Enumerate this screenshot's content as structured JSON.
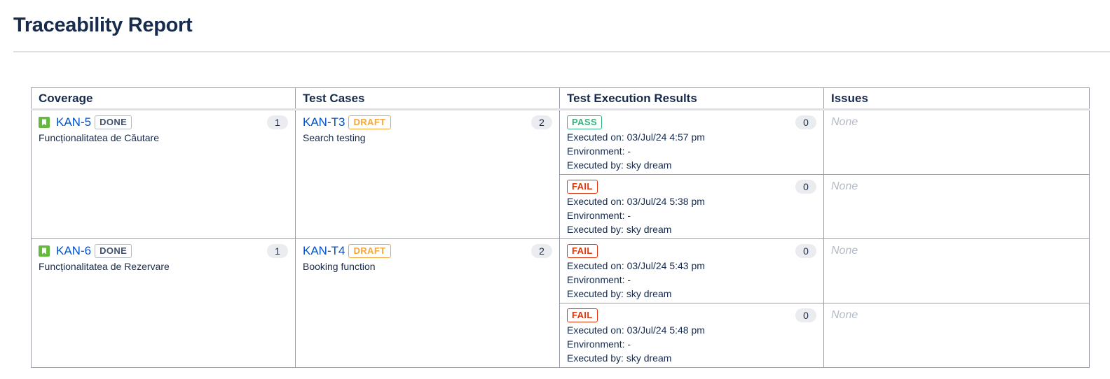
{
  "page": {
    "title": "Traceability Report"
  },
  "table": {
    "headers": [
      "Coverage",
      "Test Cases",
      "Test Execution Results",
      "Issues"
    ]
  },
  "rows": [
    {
      "coverage": {
        "key": "KAN-5",
        "status": "DONE",
        "summary": "Funcționalitatea de Căutare",
        "count": "1"
      },
      "test_case": {
        "key": "KAN-T3",
        "status": "DRAFT",
        "summary": "Search testing",
        "count": "2"
      },
      "executions": [
        {
          "result": "PASS",
          "count": "0",
          "executed_on": "Executed on: 03/Jul/24 4:57 pm",
          "environment": "Environment: -",
          "executed_by": "Executed by: sky dream",
          "issues": "None"
        },
        {
          "result": "FAIL",
          "count": "0",
          "executed_on": "Executed on: 03/Jul/24 5:38 pm",
          "environment": "Environment: -",
          "executed_by": "Executed by: sky dream",
          "issues": "None"
        }
      ]
    },
    {
      "coverage": {
        "key": "KAN-6",
        "status": "DONE",
        "summary": "Funcționalitatea de Rezervare",
        "count": "1"
      },
      "test_case": {
        "key": "KAN-T4",
        "status": "DRAFT",
        "summary": "Booking function",
        "count": "2"
      },
      "executions": [
        {
          "result": "FAIL",
          "count": "0",
          "executed_on": "Executed on: 03/Jul/24 5:43 pm",
          "environment": "Environment: -",
          "executed_by": "Executed by: sky dream",
          "issues": "None"
        },
        {
          "result": "FAIL",
          "count": "0",
          "executed_on": "Executed on: 03/Jul/24 5:48 pm",
          "environment": "Environment: -",
          "executed_by": "Executed by: sky dream",
          "issues": "None"
        }
      ]
    }
  ],
  "colors": {
    "link": "#0052cc",
    "story_icon": "#63ba3c",
    "pass": "#36b37e",
    "fail": "#de350b",
    "draft": "#f6a83c",
    "done": "#42526e"
  },
  "icons": {
    "coverage_type": "story-bookmark-icon"
  }
}
